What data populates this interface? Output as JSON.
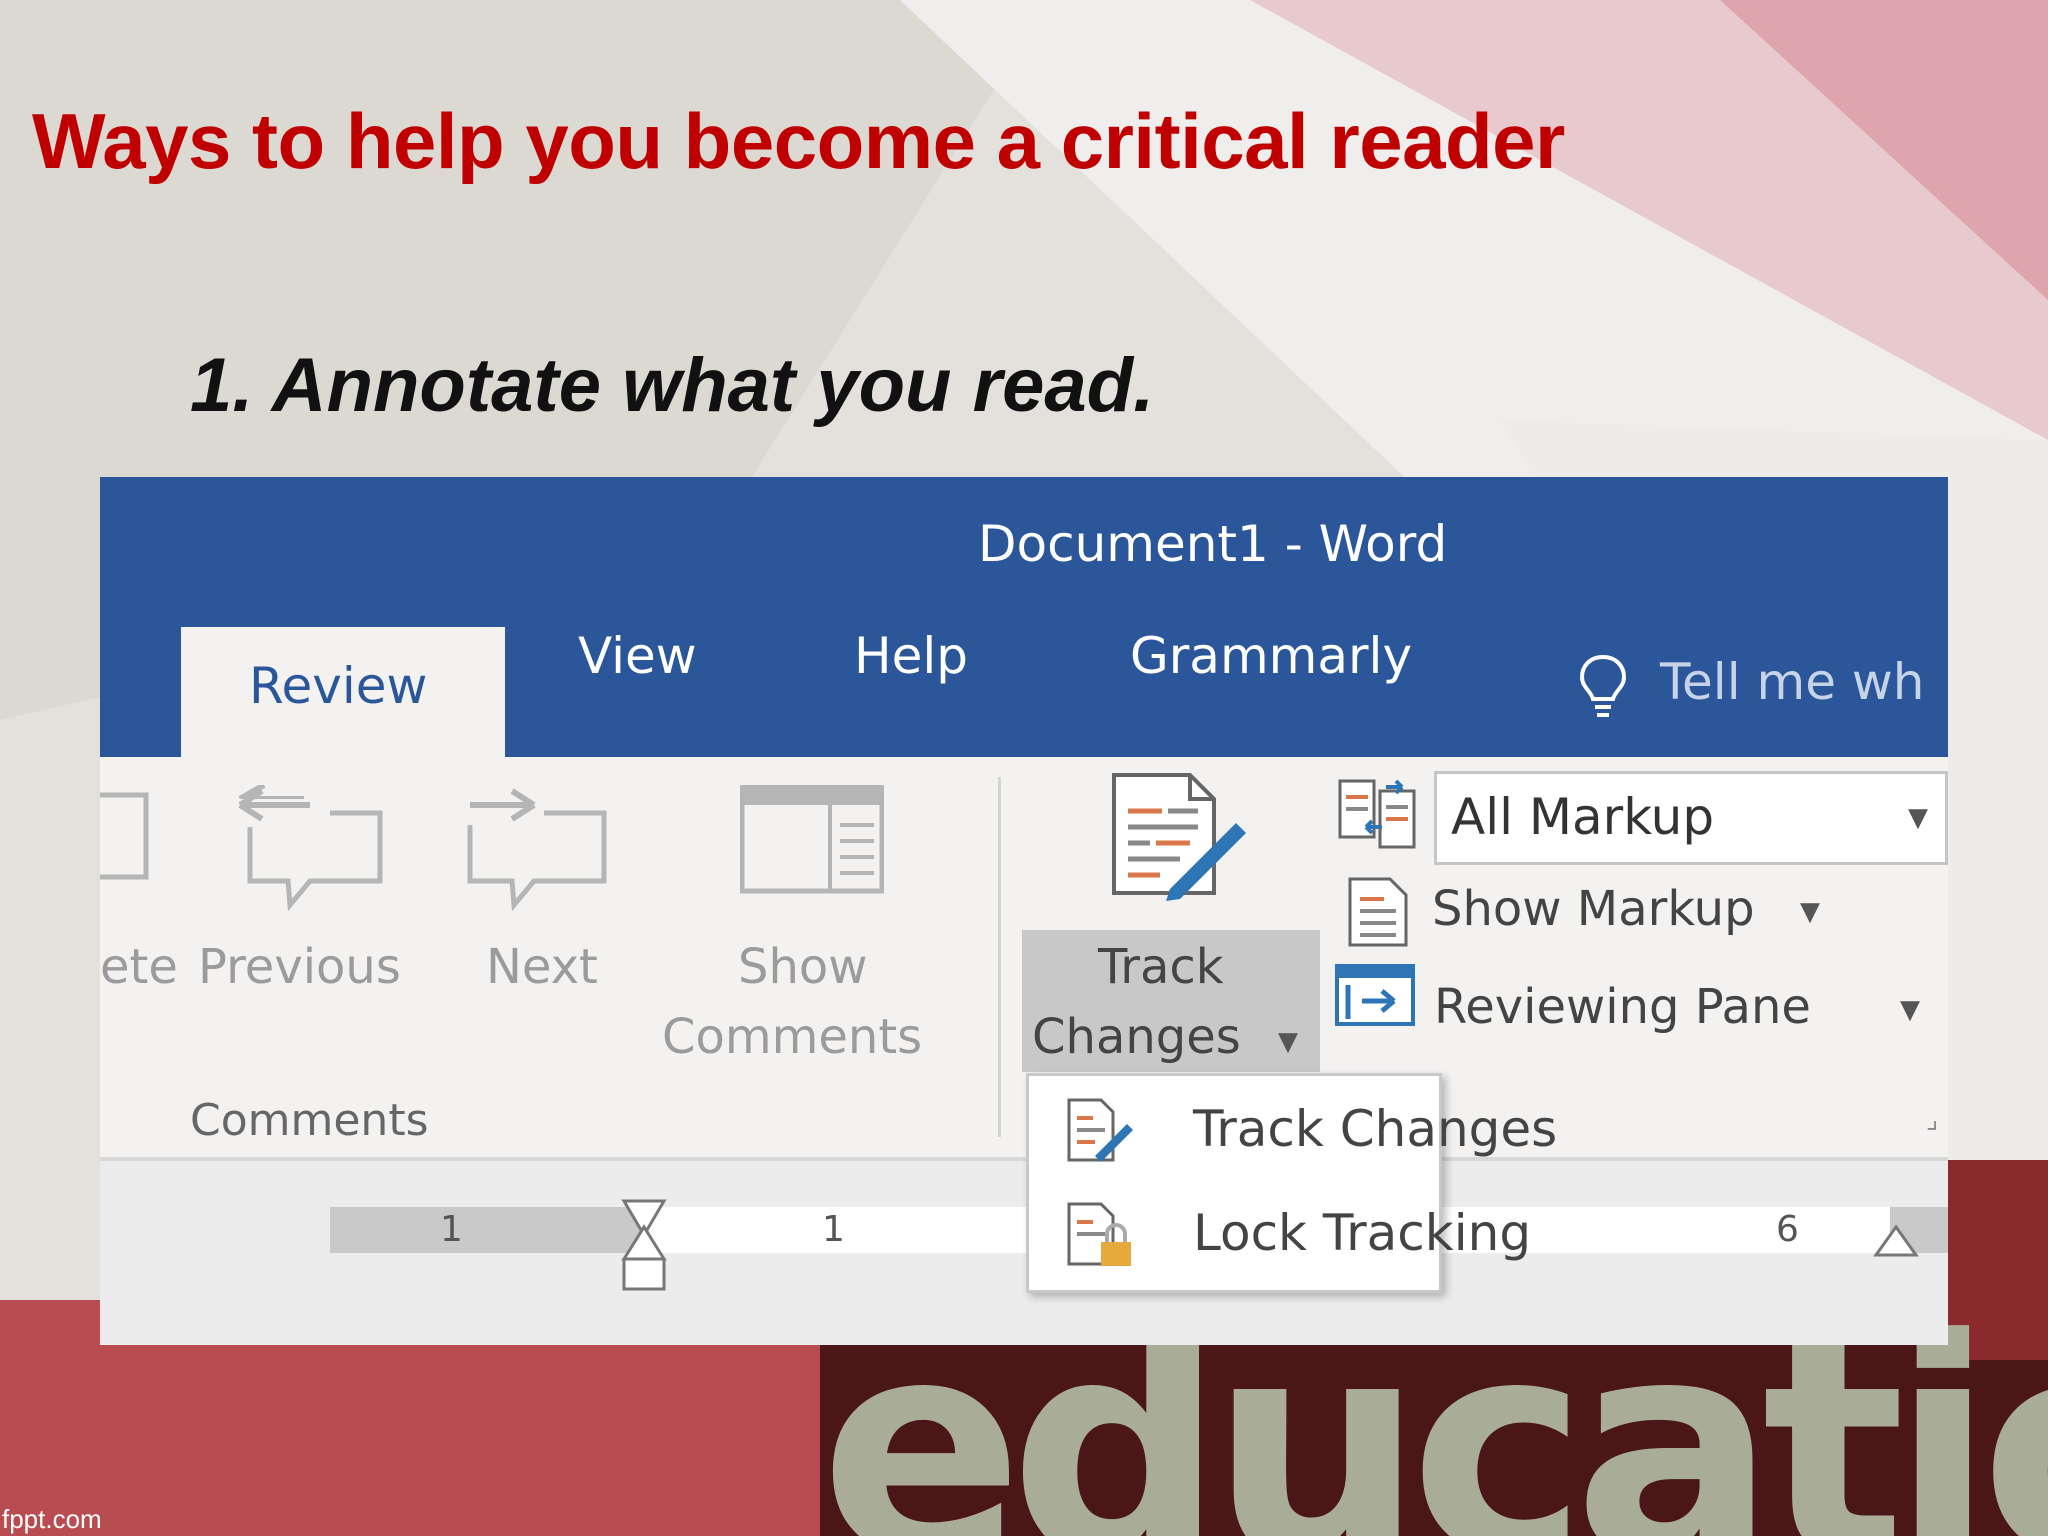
{
  "slide": {
    "title": "Ways to help you become a critical reader",
    "bullet": "1. Annotate what you read.",
    "watermark": "education",
    "credit": "fppt.com"
  },
  "word": {
    "window_title": "Document1  -  Word",
    "tabs": [
      {
        "label": "Review",
        "active": true
      },
      {
        "label": "View"
      },
      {
        "label": "Help"
      },
      {
        "label": "Grammarly"
      }
    ],
    "tell_me": "Tell me wh",
    "comments_group": {
      "delete_label": "ete",
      "previous_label": "Previous",
      "next_label": "Next",
      "show_label_1": "Show",
      "show_label_2": "Comments",
      "group_label": "Comments"
    },
    "tracking_group": {
      "track_label_1": "Track",
      "track_label_2": "Changes",
      "markup_select": "All Markup",
      "show_markup": "Show Markup",
      "reviewing_pane": "Reviewing Pane"
    },
    "dropdown": {
      "items": [
        {
          "label": "Track Changes",
          "icon": "track-changes-icon"
        },
        {
          "label": "Lock Tracking",
          "icon": "lock-tracking-icon"
        }
      ]
    },
    "ruler": {
      "ticks": [
        "1",
        "1",
        "6"
      ]
    }
  },
  "colors": {
    "title_red": "#c00000",
    "word_blue": "#2b579a"
  }
}
